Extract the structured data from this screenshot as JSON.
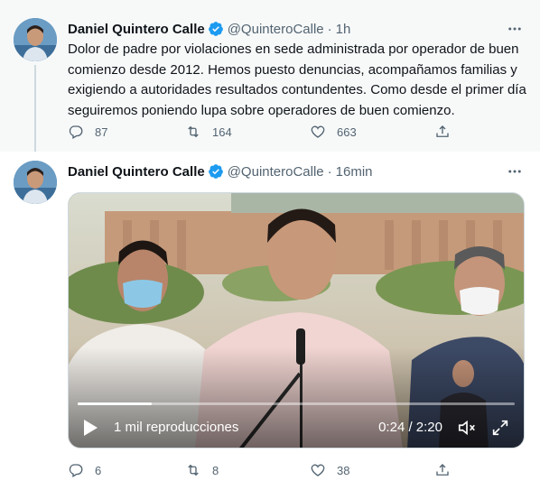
{
  "tweets": [
    {
      "author_name": "Daniel Quintero Calle",
      "handle": "@QuinteroCalle",
      "separator": "·",
      "time": "1h",
      "text": "Dolor de padre por violaciones en sede administrada por operador de buen comienzo desde 2012. Hemos puesto denuncias, acompañamos familias y exigiendo a autoridades resultados contundentes. Como desde el primer día seguiremos poniendo lupa sobre operadores de buen comienzo.",
      "replies": "87",
      "retweets": "164",
      "likes": "663"
    },
    {
      "author_name": "Daniel Quintero Calle",
      "handle": "@QuinteroCalle",
      "separator": "·",
      "time": "16min",
      "video": {
        "views": "1 mil reproducciones",
        "time": "0:24 / 2:20",
        "progress": 0.17
      },
      "replies": "6",
      "retweets": "8",
      "likes": "38"
    }
  ],
  "colors": {
    "verified": "#1d9bf0",
    "secondary_text": "#536471",
    "thread_line": "#cfd9de"
  },
  "icons": {
    "verified": "verified-badge-icon",
    "more": "more-dots-icon",
    "reply": "reply-icon",
    "retweet": "retweet-icon",
    "like": "heart-icon",
    "share": "share-icon",
    "play": "play-icon",
    "volume": "volume-icon",
    "fullscreen": "fullscreen-icon"
  }
}
